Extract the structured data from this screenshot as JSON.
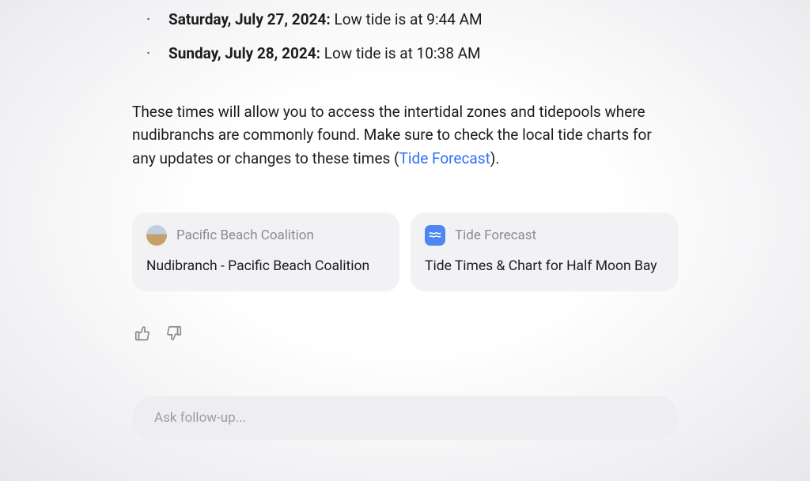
{
  "bullets": [
    {
      "date": "Saturday, July 27, 2024:",
      "text": " Low tide is at 9:44 AM"
    },
    {
      "date": "Sunday, July 28, 2024:",
      "text": " Low tide is at 10:38 AM"
    }
  ],
  "paragraph": {
    "pre": "These times will allow you to access the intertidal zones and tidepools where nudibranchs are commonly found. Make sure to check the local tide charts for any updates or changes to these times (",
    "link": "Tide Forecast",
    "post": ")."
  },
  "cards": [
    {
      "source": "Pacific Beach Coalition",
      "title": "Nudibranch - Pacific Beach Coalition",
      "icon": "beach"
    },
    {
      "source": "Tide Forecast",
      "title": "Tide Times & Chart for Half Moon Bay",
      "icon": "tide"
    }
  ],
  "input": {
    "placeholder": "Ask follow-up..."
  }
}
